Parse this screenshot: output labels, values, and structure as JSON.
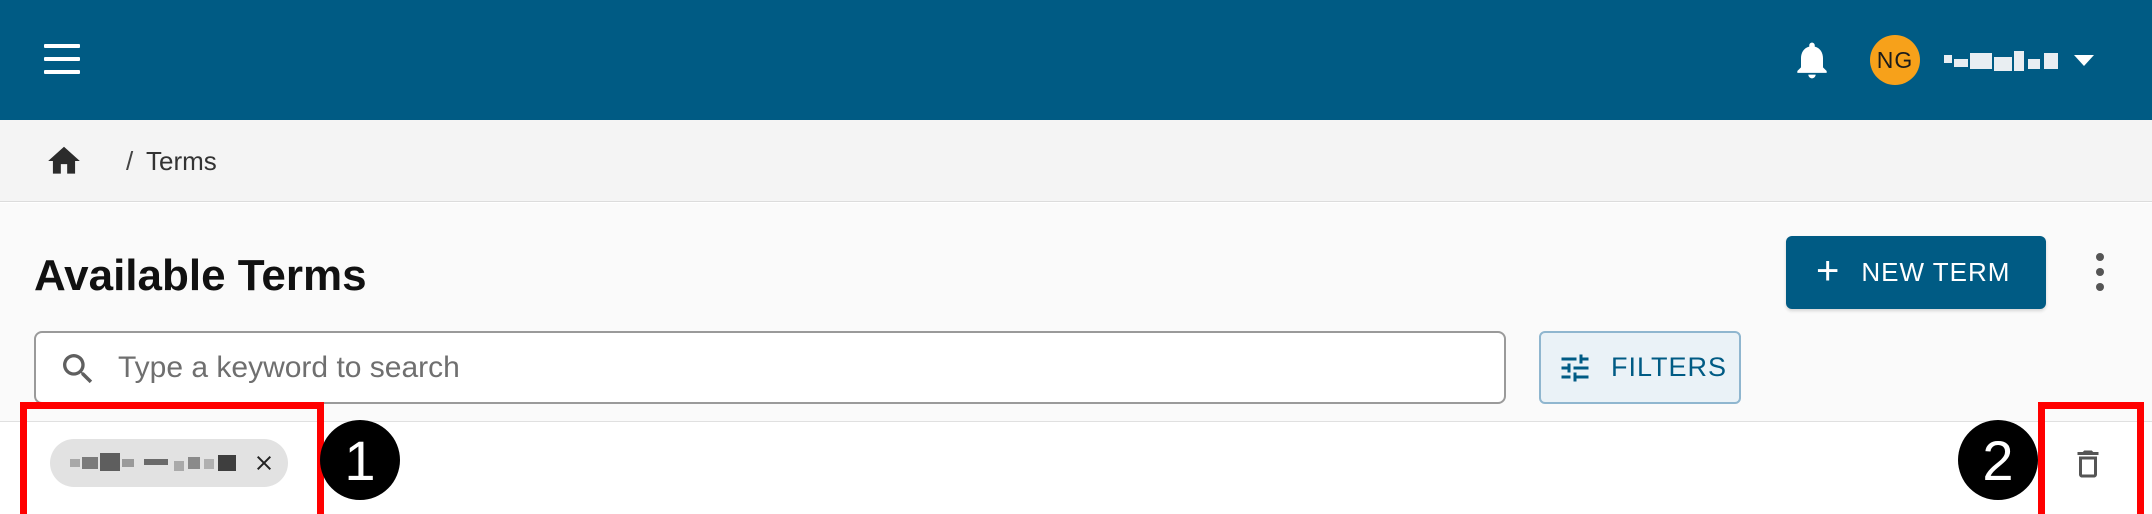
{
  "header": {
    "avatar_initials": "NG",
    "colors": {
      "bar": "#005b84",
      "avatar": "#f7a11a"
    },
    "icons": {
      "menu": "hamburger-menu-icon",
      "notifications": "bell-icon",
      "user_menu": "caret-down-icon"
    }
  },
  "breadcrumb": {
    "separator": "/",
    "current": "Terms",
    "home_icon": "home-icon"
  },
  "page": {
    "title": "Available Terms",
    "new_button": {
      "label": "NEW TERM",
      "icon": "plus-icon"
    },
    "more_icon": "more-vert-icon"
  },
  "search": {
    "placeholder": "Type a keyword to search",
    "value": "",
    "icon": "search-icon"
  },
  "filters": {
    "label": "FILTERS",
    "icon": "tune-icon"
  },
  "active_filters": {
    "chip_close_icon": "close-icon",
    "clear_all_icon": "trash-icon"
  },
  "annotations": [
    {
      "number": "1",
      "color": "#ff0000"
    },
    {
      "number": "2",
      "color": "#ff0000"
    }
  ]
}
